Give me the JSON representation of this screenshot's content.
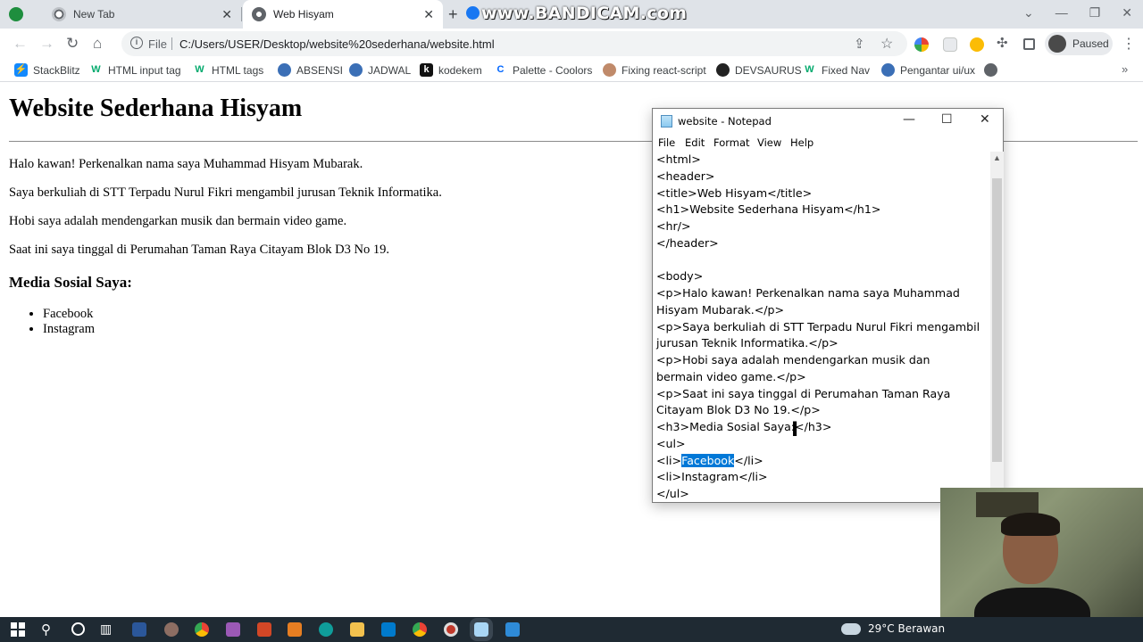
{
  "browser": {
    "tabs": [
      {
        "title": "New Tab",
        "active": false
      },
      {
        "title": "Web Hisyam",
        "active": true
      }
    ],
    "address_prefix": "File",
    "url": "C:/Users/USER/Desktop/website%20sederhana/website.html",
    "profile_status": "Paused",
    "bookmarks": [
      {
        "label": "StackBlitz",
        "icon": "stackblitz-icon"
      },
      {
        "label": "HTML input tag",
        "icon": "w3schools-icon"
      },
      {
        "label": "HTML tags",
        "icon": "w3schools-icon"
      },
      {
        "label": "ABSENSI",
        "icon": "globe-icon"
      },
      {
        "label": "JADWAL",
        "icon": "globe-icon"
      },
      {
        "label": "kodekem",
        "icon": "kodekem-icon"
      },
      {
        "label": "Palette - Coolors",
        "icon": "coolors-icon"
      },
      {
        "label": "Fixing react-script",
        "icon": "avatar-icon"
      },
      {
        "label": "DEVSAURUS",
        "icon": "devsaurus-icon"
      },
      {
        "label": "Fixed Nav",
        "icon": "w3schools-icon"
      },
      {
        "label": "Pengantar ui/ux",
        "icon": "globe-icon"
      }
    ]
  },
  "overlay": {
    "watermark": "www.BANDICAM.com"
  },
  "page": {
    "heading": "Website Sederhana Hisyam",
    "paragraphs": [
      "Halo kawan! Perkenalkan nama saya Muhammad Hisyam Mubarak.",
      "Saya berkuliah di STT Terpadu Nurul Fikri mengambil jurusan Teknik Informatika.",
      "Hobi saya adalah mendengarkan musik dan bermain video game.",
      "Saat ini saya tinggal di Perumahan Taman Raya Citayam Blok D3 No 19."
    ],
    "subheading": "Media Sosial Saya:",
    "list": [
      "Facebook",
      "Instagram"
    ]
  },
  "notepad": {
    "title": "website - Notepad",
    "menu": [
      "File",
      "Edit",
      "Format",
      "View",
      "Help"
    ],
    "lines": [
      "<html>",
      "<header>",
      "<title>Web Hisyam</title>",
      "<h1>Website Sederhana Hisyam</h1>",
      "<hr/>",
      "</header>",
      "",
      "<body>",
      "<p>Halo kawan! Perkenalkan nama saya Muhammad",
      "Hisyam Mubarak.</p>",
      "<p>Saya berkuliah di STT Terpadu Nurul Fikri mengambil",
      "jurusan Teknik Informatika.</p>",
      "<p>Hobi saya adalah mendengarkan musik dan",
      "bermain video game.</p>",
      "<p>Saat ini saya tinggal di Perumahan Taman Raya",
      "Citayam Blok D3 No 19.</p>",
      "<h3>Media Sosial Saya:</h3>",
      "<ul>",
      "<li>Facebook</li>",
      "<li>Instagram</li>",
      "</ul>"
    ],
    "selected_line_index": 18,
    "selected_text": "Facebook"
  },
  "taskbar": {
    "weather": "29°C  Berawan"
  },
  "colors": {
    "tab_strip": "#dfe3e8",
    "selection": "#0078d7",
    "taskbar": "#1f2a33"
  }
}
